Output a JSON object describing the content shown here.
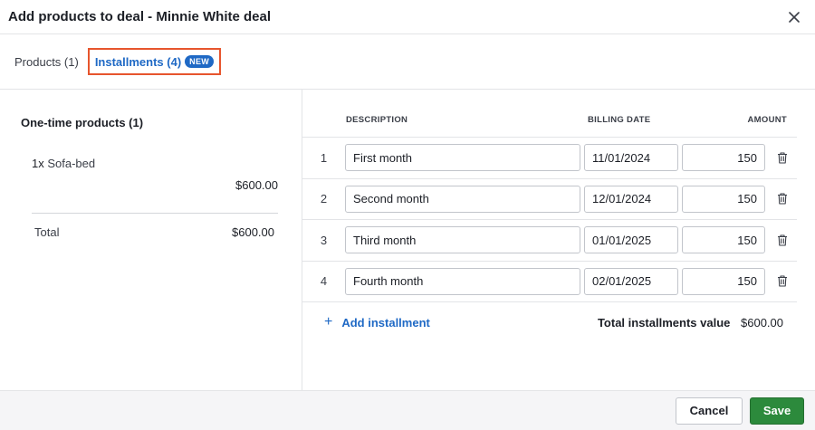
{
  "header": {
    "title": "Add products to deal - Minnie White deal"
  },
  "tabs": {
    "products": "Products (1)",
    "installments": "Installments (4)",
    "badge": "NEW"
  },
  "left": {
    "title": "One-time products (1)",
    "product": {
      "qty": "1x",
      "name": "Sofa-bed",
      "price": "$600.00"
    },
    "total_label": "Total",
    "total_value": "$600.00"
  },
  "table": {
    "headers": {
      "description": "DESCRIPTION",
      "billing_date": "BILLING DATE",
      "amount": "AMOUNT"
    },
    "rows": [
      {
        "index": "1",
        "description": "First month",
        "date": "11/01/2024",
        "amount": "150"
      },
      {
        "index": "2",
        "description": "Second month",
        "date": "12/01/2024",
        "amount": "150"
      },
      {
        "index": "3",
        "description": "Third month",
        "date": "01/01/2025",
        "amount": "150"
      },
      {
        "index": "4",
        "description": "Fourth month",
        "date": "02/01/2025",
        "amount": "150"
      }
    ],
    "add_label": "Add installment",
    "total_label": "Total installments value",
    "total_value": "$600.00"
  },
  "footer": {
    "cancel": "Cancel",
    "save": "Save"
  },
  "colors": {
    "accent": "#1f69c5",
    "highlight": "#e7552d",
    "save": "#2c8a3c"
  },
  "icons": {
    "close": "close-icon",
    "trash": "trash-icon",
    "plus": "plus-icon"
  }
}
